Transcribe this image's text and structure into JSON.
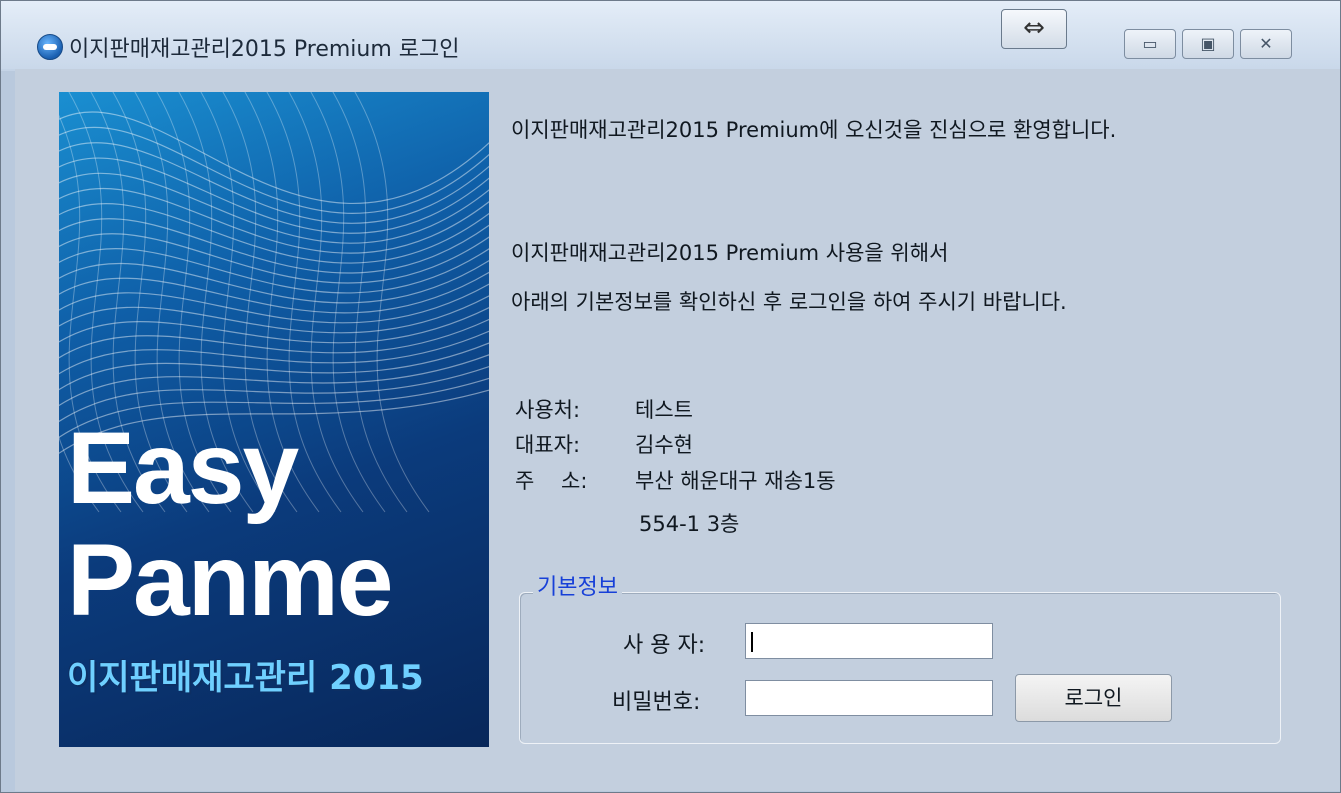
{
  "window": {
    "title": "이지판매재고관리2015 Premium 로그인",
    "resize_glyph": "⇔",
    "minimize_glyph": "▭",
    "maximize_glyph": "▣",
    "close_glyph": "✕"
  },
  "banner": {
    "line1": "Easy",
    "line2": "Panme",
    "line3": "이지판매재고관리 2015"
  },
  "welcome": {
    "line1": "이지판매재고관리2015 Premium에 오신것을 진심으로 환영합니다.",
    "line2": "이지판매재고관리2015 Premium 사용을 위해서",
    "line3": "아래의 기본정보를 확인하신 후 로그인을 하여 주시기 바랍니다."
  },
  "info": {
    "user_label": "사용처:",
    "user_value": "테스트",
    "rep_label": "대표자:",
    "rep_value": "김수현",
    "addr_label": "주    소:",
    "addr_value1": "부산 해운대구 재송1동",
    "addr_value2": "554-1 3층"
  },
  "form": {
    "group_label": "기본정보",
    "user_field_label": "사 용 자:",
    "user_field_value": "",
    "password_field_label": "비밀번호:",
    "password_field_value": "",
    "login_button": "로그인"
  }
}
